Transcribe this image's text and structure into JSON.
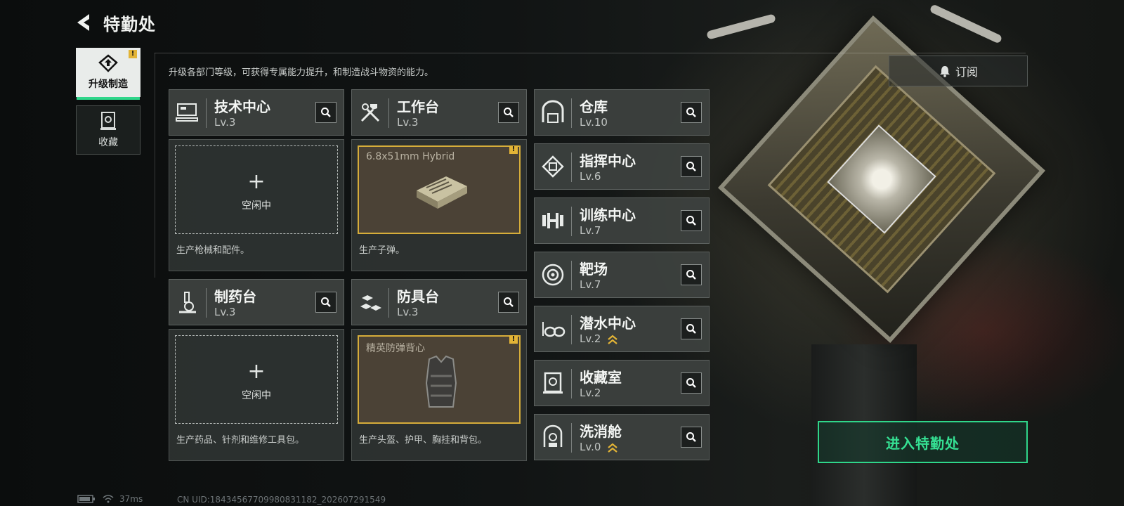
{
  "header": {
    "title": "特勤处"
  },
  "nav": {
    "items": [
      {
        "label": "升级制造",
        "active": true,
        "alert": "!"
      },
      {
        "label": "收藏",
        "active": false
      }
    ]
  },
  "subtitle": "升级各部门等级，可获得专属能力提升，和制造战斗物资的能力。",
  "subscribe": {
    "label": "订阅"
  },
  "workshops": [
    {
      "name": "技术中心",
      "level": "Lv.3",
      "slot_state": "空闲中",
      "slot_plus": "+",
      "description": "生产枪械和配件。"
    },
    {
      "name": "工作台",
      "level": "Lv.3",
      "slot_item": "6.8x51mm Hybrid",
      "alert": "!",
      "description": "生产子弹。"
    },
    {
      "name": "制药台",
      "level": "Lv.3",
      "slot_state": "空闲中",
      "slot_plus": "+",
      "description": "生产药品、针剂和维修工具包。"
    },
    {
      "name": "防具台",
      "level": "Lv.3",
      "slot_item": "精英防弹背心",
      "alert": "!",
      "description": "生产头盔、护甲、胸挂和背包。"
    }
  ],
  "facilities": [
    {
      "name": "仓库",
      "level": "Lv.10",
      "icon": "warehouse-icon"
    },
    {
      "name": "指挥中心",
      "level": "Lv.6",
      "icon": "chip-icon"
    },
    {
      "name": "训练中心",
      "level": "Lv.7",
      "icon": "dumbbell-icon"
    },
    {
      "name": "靶场",
      "level": "Lv.7",
      "icon": "target-icon"
    },
    {
      "name": "潜水中心",
      "level": "Lv.2",
      "icon": "diving-mask-icon",
      "upgrade": true
    },
    {
      "name": "收藏室",
      "level": "Lv.2",
      "icon": "collection-icon"
    },
    {
      "name": "洗消舱",
      "level": "Lv.0",
      "icon": "decon-icon",
      "upgrade": true
    }
  ],
  "enter_button": {
    "label": "进入特勤处"
  },
  "status": {
    "ping": "37ms",
    "uid": "CN UID:18434567709980831182_202607291549"
  },
  "colors": {
    "accent": "#2fd68a",
    "alert": "#e3b436",
    "active_slot": "#d6ad3a"
  }
}
